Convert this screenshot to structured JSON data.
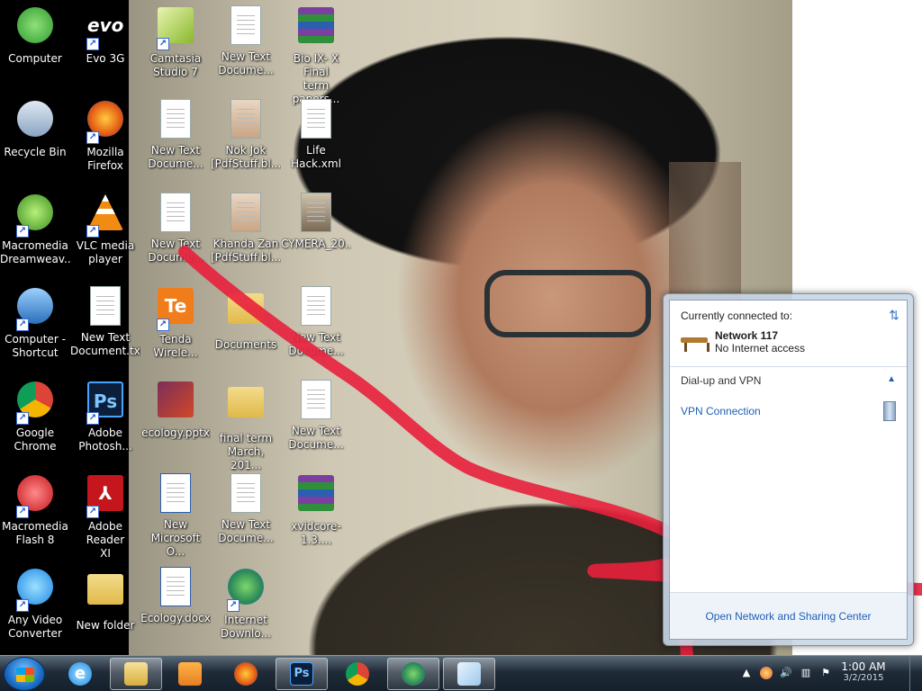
{
  "desktop": {
    "icons": [
      {
        "label": "Computer",
        "icon": "computer-shield-icon"
      },
      {
        "label": "Evo 3G",
        "icon": "evo-icon"
      },
      {
        "label": "Camtasia\nStudio 7",
        "icon": "camtasia-icon"
      },
      {
        "label": "New Text\nDocume...",
        "icon": "text-document-icon"
      },
      {
        "label": "Bio IX- X Final\nterm papers...",
        "icon": "winrar-archive-icon"
      },
      {
        "label": "Recycle Bin",
        "icon": "recycle-bin-icon"
      },
      {
        "label": "Mozilla\nFirefox",
        "icon": "firefox-icon"
      },
      {
        "label": "New Text\nDocume...",
        "icon": "text-document-icon"
      },
      {
        "label": "Nok Jok\n[PdfStuff.bl...",
        "icon": "pdf-icon"
      },
      {
        "label": "Life Hack.xml",
        "icon": "xml-icon"
      },
      {
        "label": "Macromedia\nDreamweav...",
        "icon": "dreamweaver-icon"
      },
      {
        "label": "VLC media\nplayer",
        "icon": "vlc-icon"
      },
      {
        "label": "New Text\nDocume...",
        "icon": "text-document-icon"
      },
      {
        "label": "Khanda Zan\n[PdfStuff.bl...",
        "icon": "pdf-icon"
      },
      {
        "label": "CYMERA_20...",
        "icon": "photo-icon"
      },
      {
        "label": "Computer -\nShortcut",
        "icon": "computer-icon"
      },
      {
        "label": "New Text\nDocument.txt",
        "icon": "text-document-icon"
      },
      {
        "label": "Tenda\nWirele...",
        "icon": "tenda-icon"
      },
      {
        "label": "Documents",
        "icon": "folder-icon"
      },
      {
        "label": "New Text\nDocume...",
        "icon": "text-document-icon"
      },
      {
        "label": "Google\nChrome",
        "icon": "chrome-icon"
      },
      {
        "label": "Adobe\nPhotosh...",
        "icon": "photoshop-icon"
      },
      {
        "label": "ecology.pptx",
        "icon": "powerpoint-icon"
      },
      {
        "label": "final term\nMarch, 201...",
        "icon": "folder-icon"
      },
      {
        "label": "New Text\nDocume...",
        "icon": "text-document-icon"
      },
      {
        "label": "Macromedia\nFlash 8",
        "icon": "flash-icon"
      },
      {
        "label": "Adobe Reader\nXI",
        "icon": "adobe-reader-icon"
      },
      {
        "label": "New\nMicrosoft O...",
        "icon": "word-icon"
      },
      {
        "label": "New Text\nDocume...",
        "icon": "text-document-icon"
      },
      {
        "label": "xvidcore-1.3....",
        "icon": "winrar-archive-icon"
      },
      {
        "label": "Any Video\nConverter",
        "icon": "video-converter-icon"
      },
      {
        "label": "New folder",
        "icon": "folder-icon"
      },
      {
        "label": "Ecology.docx",
        "icon": "word-icon"
      },
      {
        "label": "Internet\nDownlo...",
        "icon": "internet-download-manager-icon"
      }
    ]
  },
  "network_popup": {
    "heading": "Currently connected to:",
    "network_name": "Network  117",
    "network_status": "No Internet access",
    "dialup_heading": "Dial-up and VPN",
    "vpn_label": "VPN Connection",
    "footer_link": "Open Network and Sharing Center"
  },
  "taskbar": {
    "pinned": [
      "start-button",
      "internet-explorer-icon",
      "windows-explorer-icon",
      "media-player-icon",
      "firefox-icon",
      "photoshop-icon",
      "chrome-icon",
      "internet-download-manager-icon",
      "notepad-icon"
    ],
    "clock_time": "1:00 AM",
    "clock_date": "3/2/2015"
  },
  "colors": {
    "link": "#1f5fb5",
    "taskbar": "#1f2b38",
    "scribble": "#e8203c"
  }
}
